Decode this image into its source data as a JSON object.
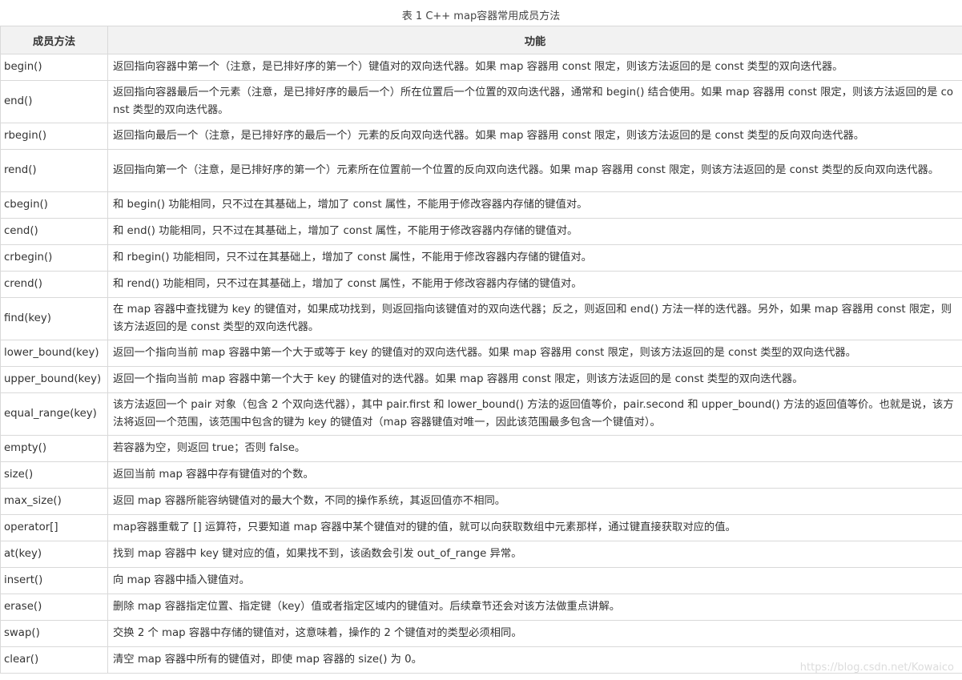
{
  "caption": "表 1 C++ map容器常用成员方法",
  "headers": {
    "method": "成员方法",
    "function": "功能"
  },
  "rows": [
    {
      "method": "begin()",
      "desc": "返回指向容器中第一个（注意，是已排好序的第一个）键值对的双向迭代器。如果 map 容器用 const 限定，则该方法返回的是 const 类型的双向迭代器。",
      "lines": 1
    },
    {
      "method": "end()",
      "desc": "返回指向容器最后一个元素（注意，是已排好序的最后一个）所在位置后一个位置的双向迭代器，通常和 begin() 结合使用。如果 map 容器用 const 限定，则该方法返回的是 const 类型的双向迭代器。",
      "lines": 2
    },
    {
      "method": "rbegin()",
      "desc": "返回指向最后一个（注意，是已排好序的最后一个）元素的反向双向迭代器。如果 map 容器用 const 限定，则该方法返回的是 const 类型的反向双向迭代器。",
      "lines": 1
    },
    {
      "method": "rend()",
      "desc": "返回指向第一个（注意，是已排好序的第一个）元素所在位置前一个位置的反向双向迭代器。如果 map 容器用 const 限定，则该方法返回的是 const 类型的反向双向迭代器。",
      "lines": 2
    },
    {
      "method": "cbegin()",
      "desc": "和 begin() 功能相同，只不过在其基础上，增加了 const 属性，不能用于修改容器内存储的键值对。",
      "lines": 1
    },
    {
      "method": "cend()",
      "desc": "和 end() 功能相同，只不过在其基础上，增加了 const 属性，不能用于修改容器内存储的键值对。",
      "lines": 1
    },
    {
      "method": "crbegin()",
      "desc": "和 rbegin() 功能相同，只不过在其基础上，增加了 const 属性，不能用于修改容器内存储的键值对。",
      "lines": 1
    },
    {
      "method": "crend()",
      "desc": "和 rend() 功能相同，只不过在其基础上，增加了 const 属性，不能用于修改容器内存储的键值对。",
      "lines": 1
    },
    {
      "method": "find(key)",
      "desc": "在 map 容器中查找键为 key 的键值对，如果成功找到，则返回指向该键值对的双向迭代器；反之，则返回和 end() 方法一样的迭代器。另外，如果 map 容器用 const 限定，则该方法返回的是 const 类型的双向迭代器。",
      "lines": 2
    },
    {
      "method": "lower_bound(key)",
      "desc": "返回一个指向当前 map 容器中第一个大于或等于 key 的键值对的双向迭代器。如果 map 容器用 const 限定，则该方法返回的是 const 类型的双向迭代器。",
      "lines": 1
    },
    {
      "method": "upper_bound(key)",
      "desc": "返回一个指向当前 map 容器中第一个大于 key 的键值对的迭代器。如果 map 容器用 const 限定，则该方法返回的是 const 类型的双向迭代器。",
      "lines": 1
    },
    {
      "method": "equal_range(key)",
      "desc": "该方法返回一个 pair 对象（包含 2 个双向迭代器），其中 pair.first 和 lower_bound() 方法的返回值等价，pair.second 和 upper_bound() 方法的返回值等价。也就是说，该方法将返回一个范围，该范围中包含的键为 key 的键值对（map 容器键值对唯一，因此该范围最多包含一个键值对）。",
      "lines": 2
    },
    {
      "method": "empty()",
      "desc": "若容器为空，则返回 true；否则 false。",
      "lines": 1
    },
    {
      "method": "size()",
      "desc": "返回当前 map 容器中存有键值对的个数。",
      "lines": 1
    },
    {
      "method": "max_size()",
      "desc": "返回 map 容器所能容纳键值对的最大个数，不同的操作系统，其返回值亦不相同。",
      "lines": 1
    },
    {
      "method": "operator[]",
      "desc": "map容器重载了 [] 运算符，只要知道 map 容器中某个键值对的键的值，就可以向获取数组中元素那样，通过键直接获取对应的值。",
      "lines": 1
    },
    {
      "method": "at(key)",
      "desc": "找到 map 容器中 key 键对应的值，如果找不到，该函数会引发 out_of_range 异常。",
      "lines": 1
    },
    {
      "method": "insert()",
      "desc": "向 map 容器中插入键值对。",
      "lines": 1
    },
    {
      "method": "erase()",
      "desc": "删除 map 容器指定位置、指定键（key）值或者指定区域内的键值对。后续章节还会对该方法做重点讲解。",
      "lines": 1
    },
    {
      "method": "swap()",
      "desc": "交换 2 个 map 容器中存储的键值对，这意味着，操作的 2 个键值对的类型必须相同。",
      "lines": 1
    },
    {
      "method": "clear()",
      "desc": "清空 map 容器中所有的键值对，即使 map 容器的 size() 为 0。",
      "lines": 1
    }
  ],
  "watermark": "https://blog.csdn.net/Kowaico"
}
